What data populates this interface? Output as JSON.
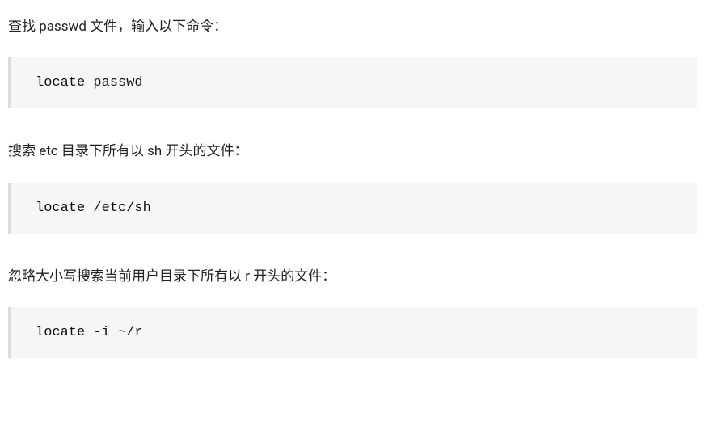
{
  "sections": [
    {
      "text": "查找 passwd 文件，输入以下命令：",
      "code": "locate passwd"
    },
    {
      "text": "搜索 etc 目录下所有以 sh 开头的文件：",
      "code": "locate /etc/sh"
    },
    {
      "text": "忽略大小写搜索当前用户目录下所有以 r 开头的文件：",
      "code": "locate -i ~/r"
    }
  ]
}
